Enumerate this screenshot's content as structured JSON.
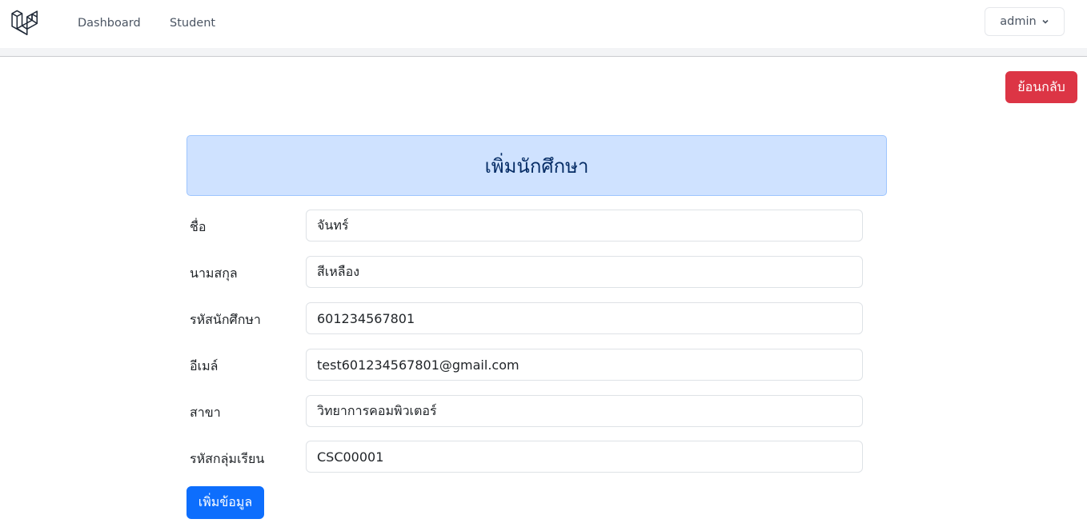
{
  "nav": {
    "links": [
      {
        "label": "Dashboard"
      },
      {
        "label": "Student"
      }
    ],
    "user_menu": {
      "label": "admin"
    }
  },
  "actions": {
    "back_label": "ย้อนกลับ",
    "submit_label": "เพิ่มข้อมูล"
  },
  "form": {
    "title": "เพิ่มนักศึกษา",
    "fields": [
      {
        "label": "ชื่อ",
        "value": "จันทร์"
      },
      {
        "label": "นามสกุล",
        "value": "สีเหลือง"
      },
      {
        "label": "รหัสนักศึกษา",
        "value": "601234567801"
      },
      {
        "label": "อีเมล์",
        "value": "test601234567801@gmail.com"
      },
      {
        "label": "สาขา",
        "value": "วิทยาการคอมพิวเตอร์"
      },
      {
        "label": "รหัสกลุ่มเรียน",
        "value": "CSC00001"
      }
    ]
  },
  "colors": {
    "danger": "#dc3545",
    "primary": "#0d6efd",
    "heading_bg": "#cfe2ff",
    "heading_text": "#052c65"
  }
}
